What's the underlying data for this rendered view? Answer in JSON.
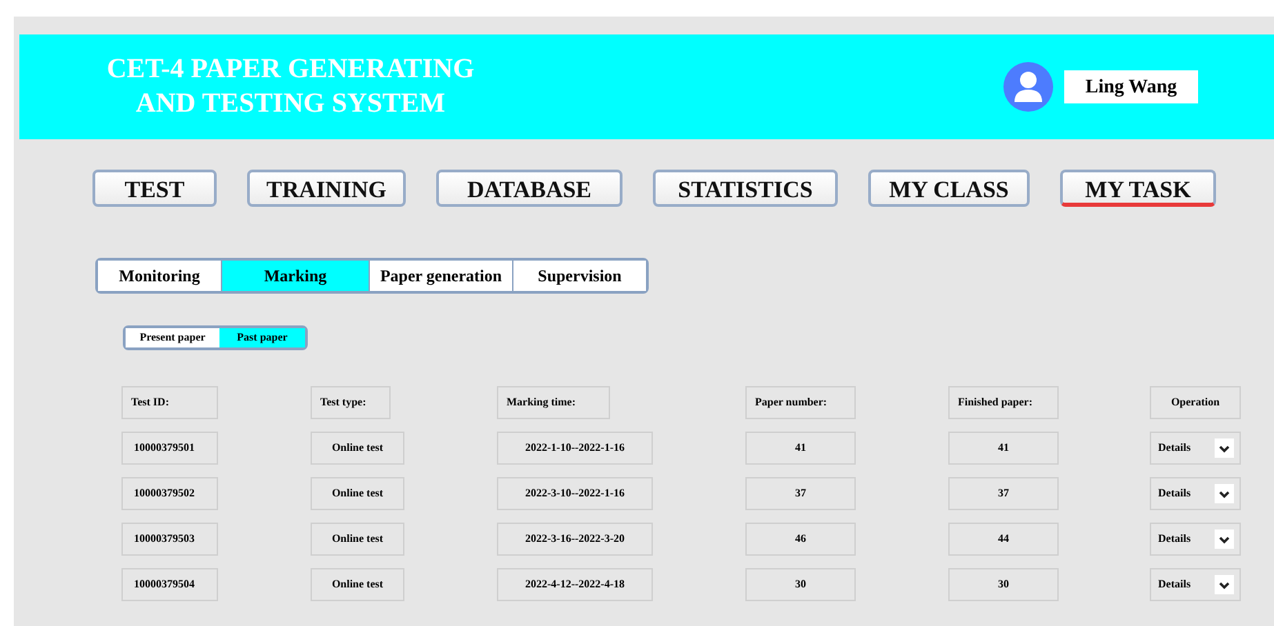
{
  "header": {
    "title_lines": [
      "CET-4 PAPER GENERATING",
      "AND TESTING SYSTEM"
    ],
    "user_name": "Ling Wang"
  },
  "nav": [
    {
      "label": "TEST",
      "selected": false
    },
    {
      "label": "TRAINING",
      "selected": false
    },
    {
      "label": "DATABASE",
      "selected": false
    },
    {
      "label": "STATISTICS",
      "selected": false
    },
    {
      "label": "MY CLASS",
      "selected": false
    },
    {
      "label": "MY TASK",
      "selected": true
    }
  ],
  "subtabs": [
    {
      "label": "Monitoring",
      "selected": false
    },
    {
      "label": "Marking",
      "selected": true
    },
    {
      "label": "Paper generation",
      "selected": false
    },
    {
      "label": "Supervision",
      "selected": false
    }
  ],
  "paper_toggle": [
    {
      "label": "Present paper",
      "selected": false
    },
    {
      "label": "Past paper",
      "selected": true
    }
  ],
  "table": {
    "columns": [
      "Test ID:",
      "Test type:",
      "Marking time:",
      "Paper number:",
      "Finished paper:",
      "Operation"
    ],
    "rows": [
      {
        "test_id": "10000379501",
        "test_type": "Online test",
        "marking_time": "2022-1-10--2022-1-16",
        "paper_number": "41",
        "finished_paper": "41",
        "operation": "Details"
      },
      {
        "test_id": "10000379502",
        "test_type": "Online test",
        "marking_time": "2022-3-10--2022-1-16",
        "paper_number": "37",
        "finished_paper": "37",
        "operation": "Details"
      },
      {
        "test_id": "10000379503",
        "test_type": "Online test",
        "marking_time": "2022-3-16--2022-3-20",
        "paper_number": "46",
        "finished_paper": "44",
        "operation": "Details"
      },
      {
        "test_id": "10000379504",
        "test_type": "Online test",
        "marking_time": "2022-4-12--2022-4-18",
        "paper_number": "30",
        "finished_paper": "30",
        "operation": "Details"
      }
    ]
  }
}
